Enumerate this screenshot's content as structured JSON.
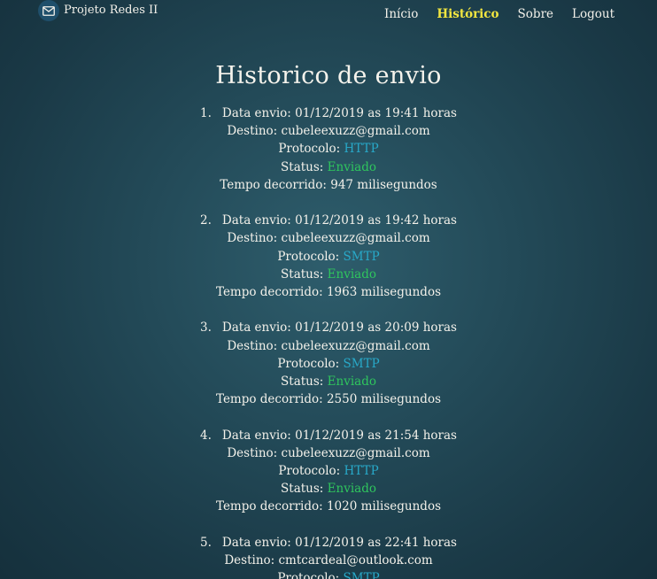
{
  "navbar": {
    "brand": "Projeto Redes II",
    "brand_icon": "envelope-icon",
    "links": [
      {
        "label": "Início",
        "active": false
      },
      {
        "label": "Histórico",
        "active": true
      },
      {
        "label": "Sobre",
        "active": false
      },
      {
        "label": "Logout",
        "active": false
      }
    ]
  },
  "colors": {
    "active_link": "#f2e640",
    "protocol": "#28a9c9",
    "status": "#2fc65d"
  },
  "page": {
    "title": "Historico de envio"
  },
  "labels": {
    "date": "Data envio:",
    "dest": "Destino:",
    "protocol": "Protocolo:",
    "status": "Status:",
    "time": "Tempo decorrido:"
  },
  "entries": [
    {
      "num": "1.",
      "date": "01/12/2019 as 19:41 horas",
      "dest": "cubeleexuzz@gmail.com",
      "protocol": "HTTP",
      "status": "Enviado",
      "time": "947 milisegundos"
    },
    {
      "num": "2.",
      "date": "01/12/2019 as 19:42 horas",
      "dest": "cubeleexuzz@gmail.com",
      "protocol": "SMTP",
      "status": "Enviado",
      "time": "1963 milisegundos"
    },
    {
      "num": "3.",
      "date": "01/12/2019 as 20:09 horas",
      "dest": "cubeleexuzz@gmail.com",
      "protocol": "SMTP",
      "status": "Enviado",
      "time": "2550 milisegundos"
    },
    {
      "num": "4.",
      "date": "01/12/2019 as 21:54 horas",
      "dest": "cubeleexuzz@gmail.com",
      "protocol": "HTTP",
      "status": "Enviado",
      "time": "1020 milisegundos"
    },
    {
      "num": "5.",
      "date": "01/12/2019 as 22:41 horas",
      "dest": "cmtcardeal@outlook.com",
      "protocol": "SMTP",
      "status": "",
      "time": ""
    }
  ]
}
